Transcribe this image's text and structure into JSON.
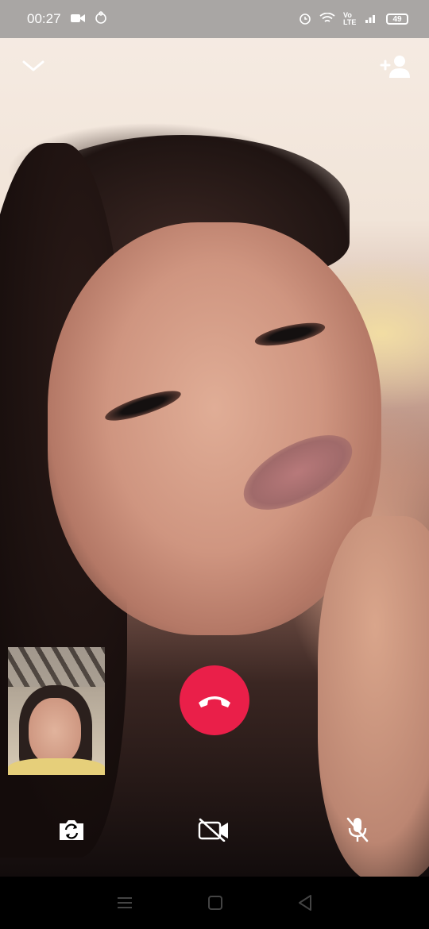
{
  "status_bar": {
    "time": "00:27",
    "network_label": "Vo LTE",
    "battery_level": "49"
  },
  "call": {
    "colors": {
      "end_call": "#ea1f49",
      "icon": "#ffffff"
    },
    "icons": {
      "collapse": "chevron-down-icon",
      "add_participant": "add-person-icon",
      "end_call": "end-call-icon",
      "flip_camera": "flip-camera-icon",
      "video_off": "video-off-icon",
      "mic_off": "mic-off-icon"
    }
  },
  "navigation": {
    "icons": [
      "menu-icon",
      "home-icon",
      "back-icon"
    ]
  }
}
